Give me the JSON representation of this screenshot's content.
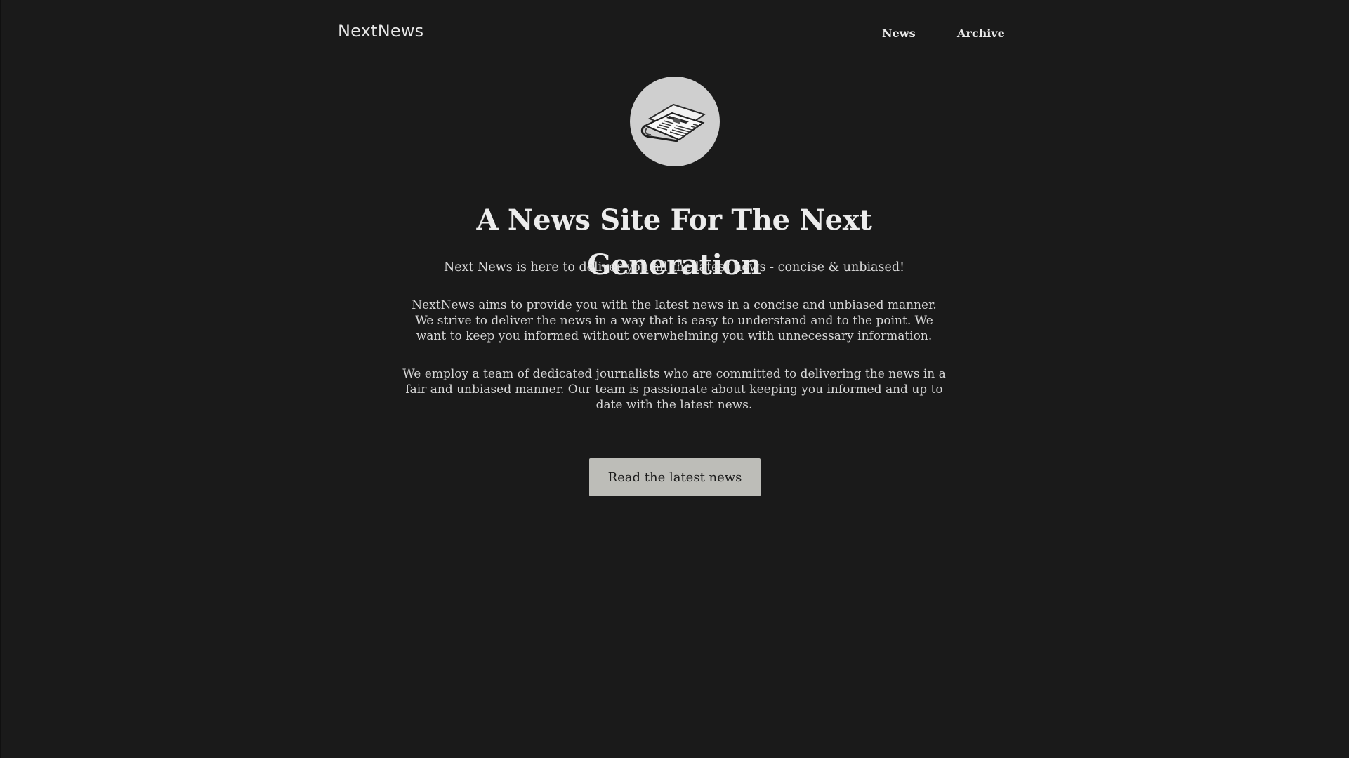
{
  "header": {
    "brand": "NextNews",
    "nav": [
      {
        "label": "News"
      },
      {
        "label": "Archive"
      }
    ]
  },
  "hero": {
    "logo_icon": "newspaper-icon",
    "title": "A News Site For The Next Generation",
    "subtitle": "Next News is here to deliver you all the latest news - concise & unbiased!",
    "paragraphs": [
      "NextNews aims to provide you with the latest news in a concise and unbiased manner. We strive to deliver the news in a way that is easy to understand and to the point. We want to keep you informed without overwhelming you with unnecessary information.",
      "We employ a team of dedicated journalists who are committed to delivering the news in a fair and unbiased manner. Our team is passionate about keeping you informed and up to date with the latest news."
    ],
    "cta_label": "Read the latest news"
  },
  "colors": {
    "background": "#1a1a1a",
    "text": "#e3e3e3",
    "logo_background": "#cfcfcf",
    "button_background": "#bdbdb8",
    "button_text": "#1b1b1b"
  }
}
